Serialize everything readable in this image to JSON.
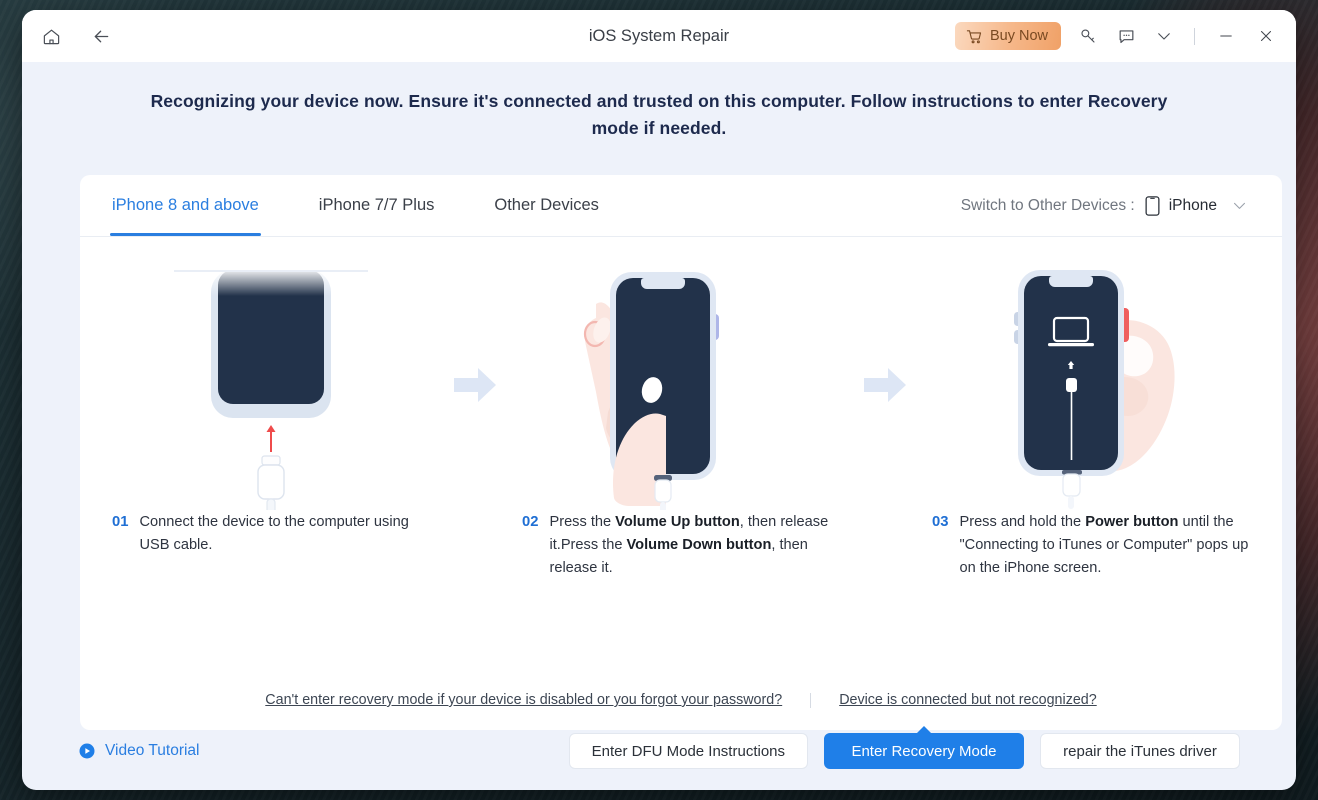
{
  "window": {
    "title": "iOS System Repair",
    "home_icon": "home-icon",
    "back_icon": "back-arrow-icon",
    "buy_now_label": "Buy Now",
    "cart_icon": "cart-icon",
    "key_icon": "key-icon",
    "feedback_icon": "chat-bubble-icon",
    "more_icon": "chevron-down-icon",
    "minimize_icon": "minimize-icon",
    "close_icon": "close-icon"
  },
  "headline": "Recognizing your device now. Ensure it's connected and trusted on this computer. Follow instructions to enter Recovery mode if needed.",
  "tabs": [
    {
      "label": "iPhone 8 and above",
      "active": true
    },
    {
      "label": "iPhone 7/7 Plus",
      "active": false
    },
    {
      "label": "Other Devices",
      "active": false
    }
  ],
  "switch_device": {
    "label": "Switch to Other Devices :",
    "value": "iPhone",
    "device_icon": "phone-icon",
    "chevron_icon": "chevron-down-icon"
  },
  "steps": [
    {
      "num": "01",
      "text_parts": [
        {
          "t": "Connect the device to the computer using USB cable.",
          "bold": false
        }
      ]
    },
    {
      "num": "02",
      "text_parts": [
        {
          "t": "Press the ",
          "bold": false
        },
        {
          "t": "Volume Up button",
          "bold": true
        },
        {
          "t": ", then release it.Press the ",
          "bold": false
        },
        {
          "t": "Volume Down button",
          "bold": true
        },
        {
          "t": ", then release it.",
          "bold": false
        }
      ]
    },
    {
      "num": "03",
      "text_parts": [
        {
          "t": "Press and hold the ",
          "bold": false
        },
        {
          "t": "Power button",
          "bold": true
        },
        {
          "t": " until the \"Connecting to iTunes or Computer\" pops up on the iPhone screen.",
          "bold": false
        }
      ]
    }
  ],
  "card_links": {
    "left": "Can't enter recovery mode if your device is disabled or you forgot your password?",
    "right": "Device is connected but not recognized?"
  },
  "footer": {
    "video_tutorial": "Video Tutorial",
    "play_icon": "play-circle-icon",
    "buttons": [
      {
        "label": "Enter DFU Mode Instructions",
        "primary": false
      },
      {
        "label": "Enter Recovery Mode",
        "primary": true
      },
      {
        "label": "repair the iTunes driver",
        "primary": false
      }
    ]
  },
  "colors": {
    "accent": "#1f7fe8",
    "tab_active": "#2a7ee0",
    "headline": "#1d2a4d",
    "device_dark": "#22324a",
    "buy_now_start": "#fbd9bf",
    "buy_now_end": "#f0a167",
    "highlight_red": "#f05b5b",
    "button_purple": "#aeb6e8"
  }
}
